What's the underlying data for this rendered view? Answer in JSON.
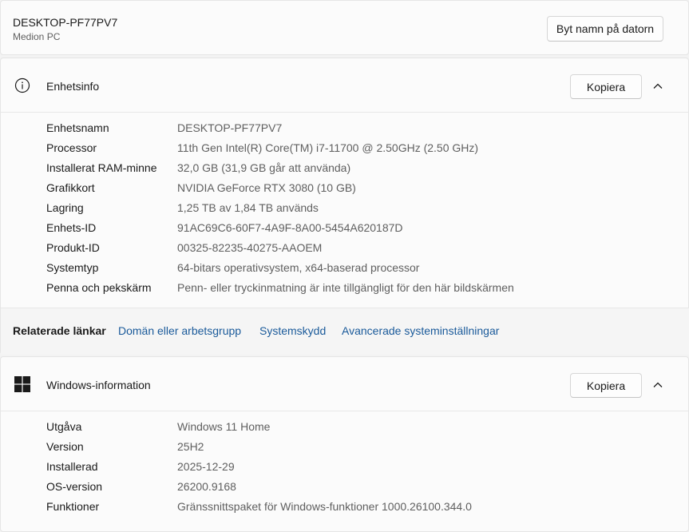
{
  "device": {
    "name": "DESKTOP-PF77PV7",
    "model": "Medion PC",
    "rename_label": "Byt namn på datorn"
  },
  "device_specs": {
    "title": "Enhetsinfo",
    "icon": "info-icon",
    "copy_label": "Kopiera",
    "rows": [
      {
        "key": "Enhetsnamn",
        "value": "DESKTOP-PF77PV7"
      },
      {
        "key": "Processor",
        "value": "11th Gen Intel(R) Core(TM) i7-11700 @ 2.50GHz (2.50 GHz)"
      },
      {
        "key": "Installerat RAM-minne",
        "value": "32,0 GB (31,9 GB går att använda)"
      },
      {
        "key": "Grafikkort",
        "value": "NVIDIA GeForce RTX 3080 (10 GB)"
      },
      {
        "key": "Lagring",
        "value": "1,25 TB av 1,84 TB används"
      },
      {
        "key": "Enhets-ID",
        "value": "91AC69C6-60F7-4A9F-8A00-5454A620187D"
      },
      {
        "key": "Produkt-ID",
        "value": "00325-82235-40275-AAOEM"
      },
      {
        "key": "Systemtyp",
        "value": "64-bitars operativsystem, x64-baserad processor"
      },
      {
        "key": "Penna och pekskärm",
        "value": "Penn- eller tryckinmatning är inte tillgängligt för den här bildskärmen"
      }
    ]
  },
  "related": {
    "label": "Relaterade länkar",
    "links": [
      "Domän eller arbetsgrupp",
      "Systemskydd",
      "Avancerade systeminställningar"
    ]
  },
  "windows_specs": {
    "title": "Windows-information",
    "icon": "windows-logo-icon",
    "copy_label": "Kopiera",
    "rows": [
      {
        "key": "Utgåva",
        "value": "Windows 11 Home"
      },
      {
        "key": "Version",
        "value": "25H2"
      },
      {
        "key": "Installerad",
        "value": "2025-12-29"
      },
      {
        "key": "OS-version",
        "value": "26200.9168"
      },
      {
        "key": "Funktioner",
        "value": "Gränssnittspaket för Windows-funktioner 1000.26100.344.0"
      }
    ]
  }
}
